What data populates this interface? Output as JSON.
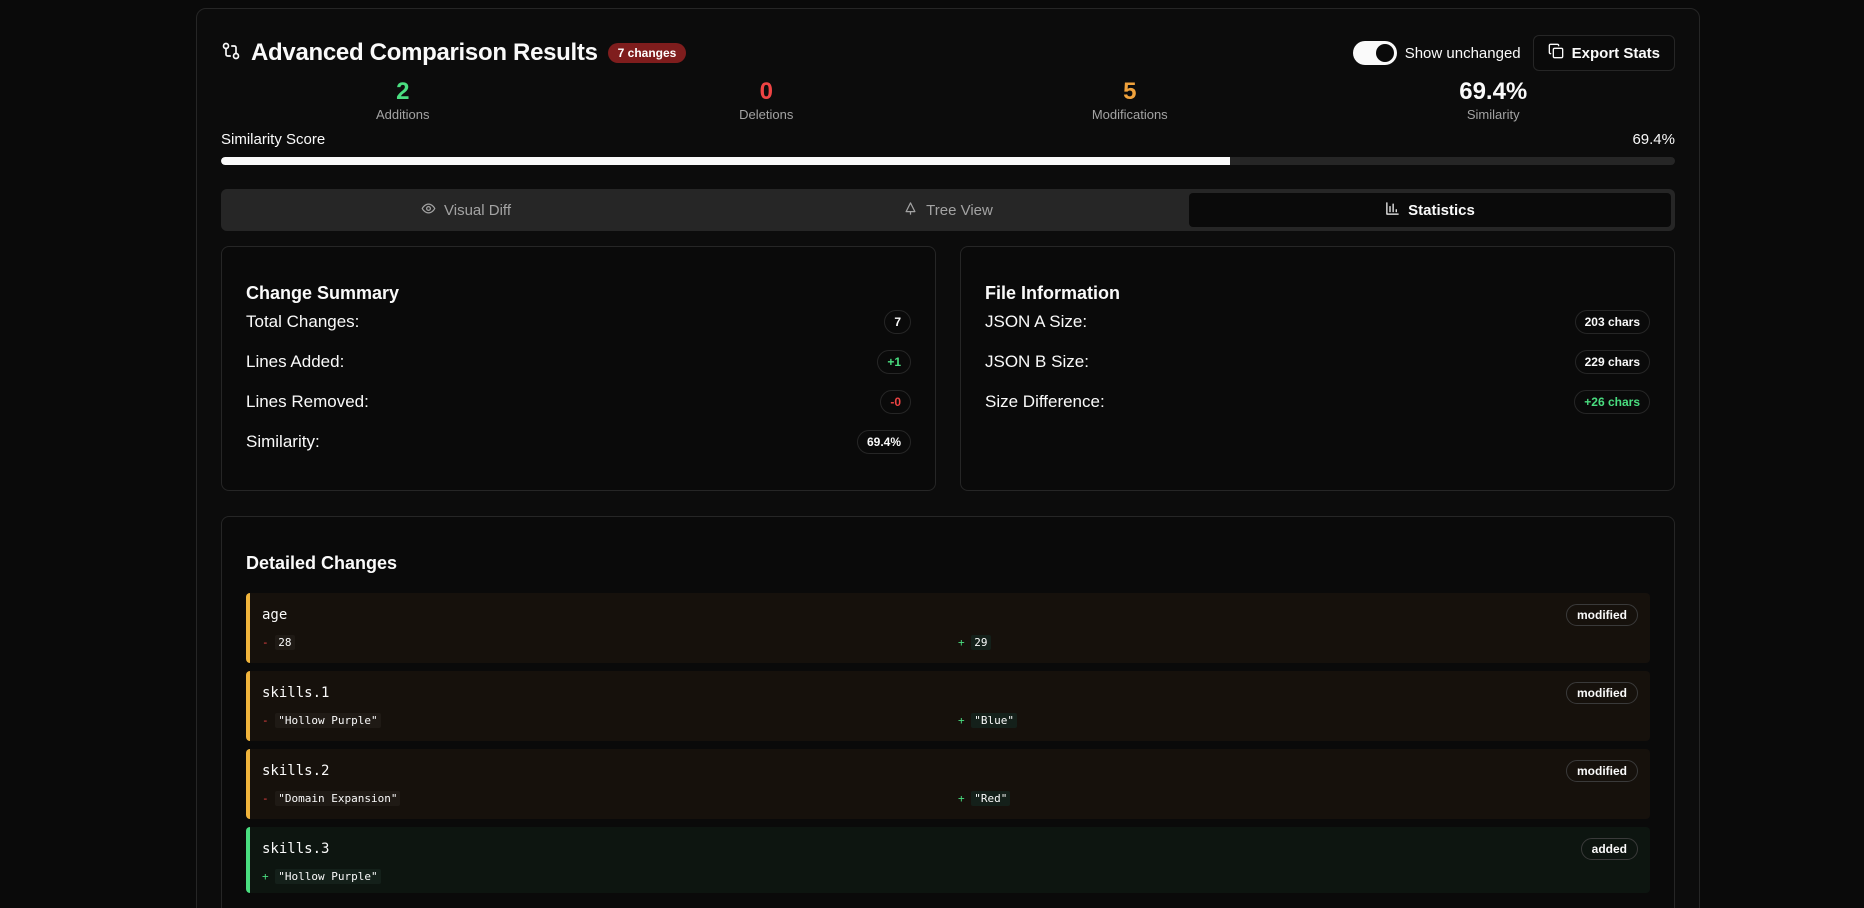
{
  "header": {
    "title": "Advanced Comparison Results",
    "changes_badge": "7 changes",
    "toggle_label": "Show unchanged",
    "toggle_on": true,
    "export_label": "Export Stats"
  },
  "stats": [
    {
      "value": "2",
      "label": "Additions",
      "color": "#4ade80"
    },
    {
      "value": "0",
      "label": "Deletions",
      "color": "#ef4444"
    },
    {
      "value": "5",
      "label": "Modifications",
      "color": "#f97316"
    },
    {
      "value": "69.4%",
      "label": "Similarity",
      "color": "#fafafa"
    }
  ],
  "similarity": {
    "label": "Similarity Score",
    "value_text": "69.4%",
    "fraction": 0.694
  },
  "tabs": [
    {
      "label": "Visual Diff",
      "icon": "eye-icon",
      "active": false
    },
    {
      "label": "Tree View",
      "icon": "tree-icon",
      "active": false
    },
    {
      "label": "Statistics",
      "icon": "bar-chart-icon",
      "active": true
    }
  ],
  "change_summary": {
    "title": "Change Summary",
    "rows": [
      {
        "label": "Total Changes:",
        "value": "7"
      },
      {
        "label": "Lines Added:",
        "value": "+1"
      },
      {
        "label": "Lines Removed:",
        "value": "-0"
      },
      {
        "label": "Similarity:",
        "value": "69.4%"
      }
    ]
  },
  "file_info": {
    "title": "File Information",
    "rows": [
      {
        "label": "JSON A Size:",
        "value": "203 chars"
      },
      {
        "label": "JSON B Size:",
        "value": "229 chars"
      },
      {
        "label": "Size Difference:",
        "value": "+26 chars"
      }
    ]
  },
  "detailed_changes": {
    "title": "Detailed Changes",
    "items": [
      {
        "path": "age",
        "kind": "modified",
        "old": "28",
        "new": "29"
      },
      {
        "path": "skills.1",
        "kind": "modified",
        "old": "\"Hollow Purple\"",
        "new": "\"Blue\""
      },
      {
        "path": "skills.2",
        "kind": "modified",
        "old": "\"Domain Expansion\"",
        "new": "\"Red\""
      },
      {
        "path": "skills.3",
        "kind": "added",
        "new": "\"Hollow Purple\""
      }
    ]
  },
  "signs": {
    "minus": "-",
    "plus": "+"
  }
}
